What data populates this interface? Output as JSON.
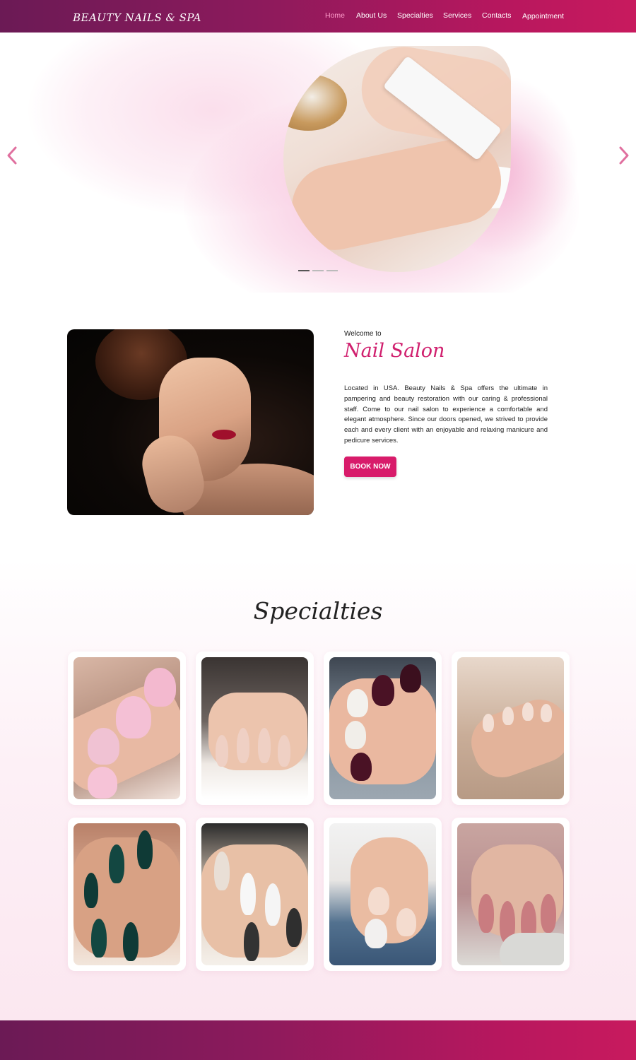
{
  "header": {
    "brand": "BEAUTY NAILS & SPA",
    "nav": [
      {
        "label": "Home",
        "active": true
      },
      {
        "label": "About Us",
        "active": false
      },
      {
        "label": "Specialties",
        "active": false
      },
      {
        "label": "Services",
        "active": false
      },
      {
        "label": "Contacts",
        "active": false
      },
      {
        "label": "Appointment",
        "active": false
      }
    ]
  },
  "hero": {
    "prev_icon": "chevron-left-icon",
    "next_icon": "chevron-right-icon",
    "slide_count": 3,
    "active_slide": 1
  },
  "welcome": {
    "small": "Welcome to",
    "title": "Nail Salon",
    "body": "Located in USA. Beauty Nails & Spa offers the ultimate in pampering and beauty restoration with our caring & professional staff. Come to our nail salon to experience a comfortable and elegant atmosphere. Since our doors opened, we strived to provide each and every client with an enjoyable and relaxing manicure and pedicure services.",
    "button": "BOOK NOW"
  },
  "specialties": {
    "title": "Specialties",
    "items": [
      {
        "alt": "pink-matte-nails"
      },
      {
        "alt": "nude-nails-rings"
      },
      {
        "alt": "white-burgundy-nails"
      },
      {
        "alt": "nude-art-nails"
      },
      {
        "alt": "emerald-stiletto-nails"
      },
      {
        "alt": "white-glitter-nails"
      },
      {
        "alt": "marble-nails-denim"
      },
      {
        "alt": "pink-nails-rings"
      }
    ]
  },
  "colors": {
    "accent": "#d81b6a",
    "header_gradient_start": "#6b1a55",
    "header_gradient_end": "#c81a5e",
    "active_nav": "#ff9ccb"
  }
}
